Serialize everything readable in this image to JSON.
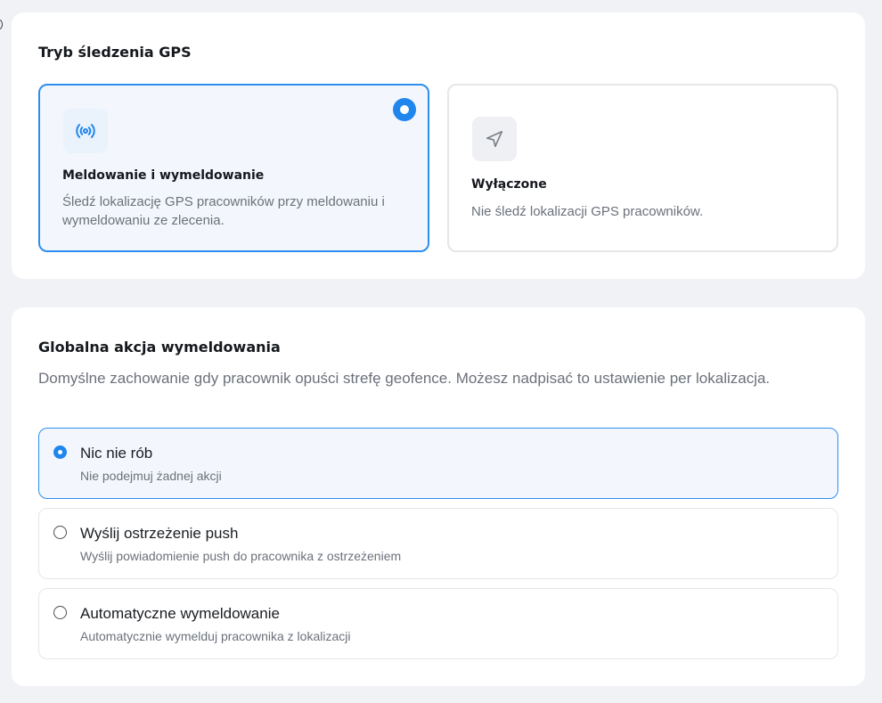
{
  "gps_section": {
    "title": "Tryb śledzenia GPS",
    "options": [
      {
        "title": "Meldowanie i wymeldowanie",
        "description": "Śledź lokalizację GPS pracowników przy meldowaniu i wymeldowaniu ze zlecenia.",
        "icon": "broadcast-icon",
        "selected": true
      },
      {
        "title": "Wyłączone",
        "description": "Nie śledź lokalizacji GPS pracowników.",
        "icon": "navigation-arrow-icon",
        "selected": false
      }
    ]
  },
  "action_section": {
    "title": "Globalna akcja wymeldowania",
    "description": "Domyślne zachowanie gdy pracownik opuści strefę geofence. Możesz nadpisać to ustawienie per lokalizacja.",
    "options": [
      {
        "label": "Nic nie rób",
        "description": "Nie podejmuj żadnej akcji",
        "selected": true
      },
      {
        "label": "Wyślij ostrzeżenie push",
        "description": "Wyślij powiadomienie push do pracownika z ostrzeżeniem",
        "selected": false
      },
      {
        "label": "Automatyczne wymeldowanie",
        "description": "Automatycznie wymelduj pracownika z lokalizacji",
        "selected": false
      }
    ]
  },
  "colors": {
    "accent": "#1f86ee",
    "selected_bg": "#f3f7fd",
    "page_bg": "#f1f2f5"
  }
}
